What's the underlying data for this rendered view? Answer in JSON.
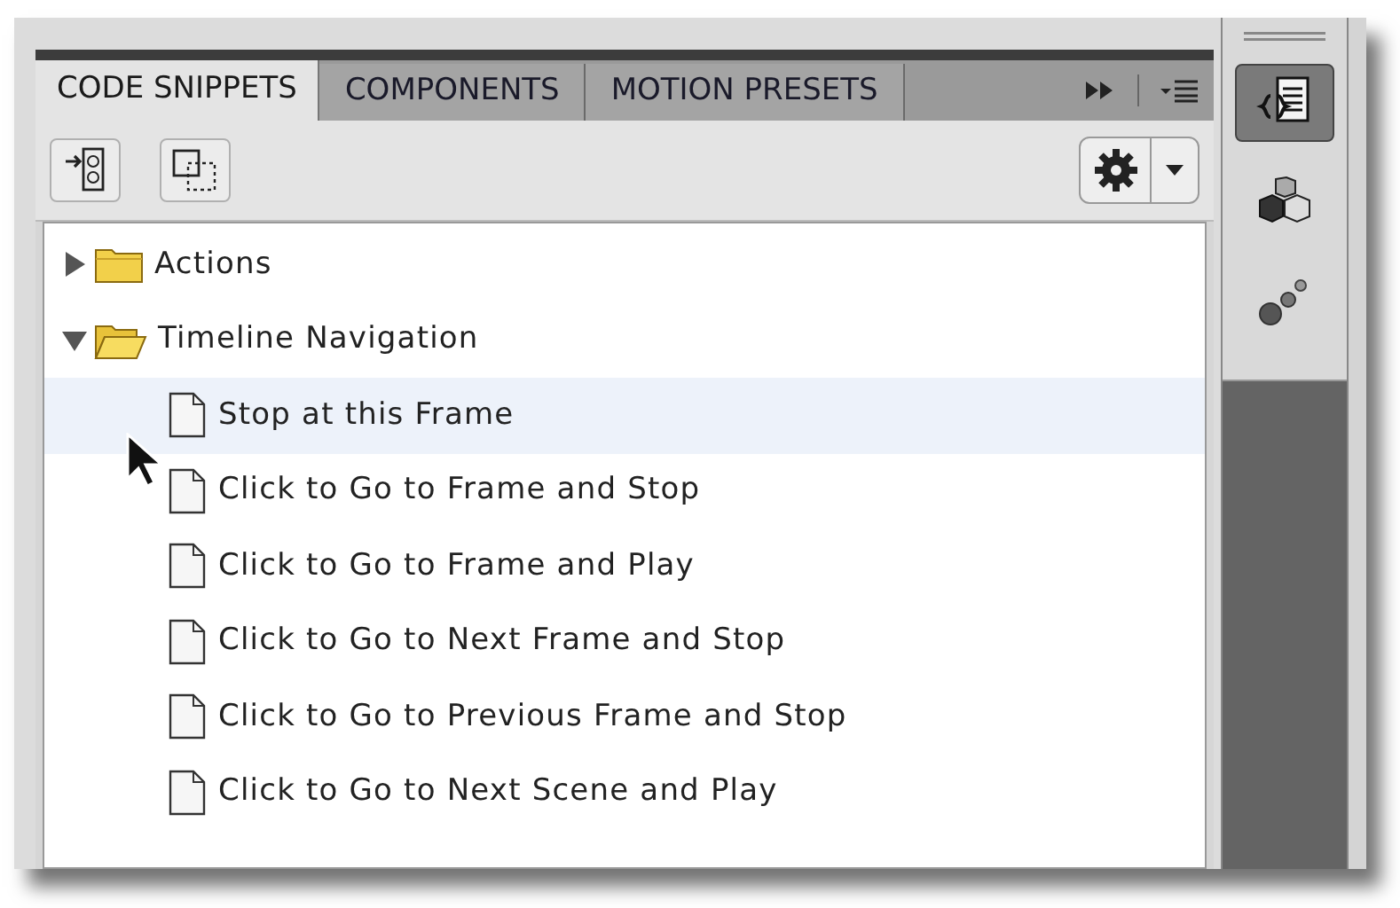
{
  "tabs": [
    {
      "label": "CODE SNIPPETS",
      "selected": true
    },
    {
      "label": "COMPONENTS",
      "selected": false
    },
    {
      "label": "MOTION PRESETS",
      "selected": false
    }
  ],
  "tree": [
    {
      "kind": "folder",
      "label": "Actions",
      "expanded": false,
      "selected": false
    },
    {
      "kind": "folder",
      "label": "Timeline Navigation",
      "expanded": true,
      "selected": false,
      "children": [
        {
          "kind": "snippet",
          "label": "Stop at this Frame",
          "selected": true
        },
        {
          "kind": "snippet",
          "label": "Click to Go to Frame and Stop",
          "selected": false
        },
        {
          "kind": "snippet",
          "label": "Click to Go to Frame and Play",
          "selected": false
        },
        {
          "kind": "snippet",
          "label": "Click to Go to Next Frame and Stop",
          "selected": false
        },
        {
          "kind": "snippet",
          "label": "Click to Go to Previous Frame and Stop",
          "selected": false
        },
        {
          "kind": "snippet",
          "label": "Click to Go to Next Scene and Play",
          "selected": false
        }
      ]
    }
  ],
  "dock": [
    {
      "kind": "snippets",
      "selected": true
    },
    {
      "kind": "components",
      "selected": false
    },
    {
      "kind": "presets",
      "selected": false
    }
  ]
}
